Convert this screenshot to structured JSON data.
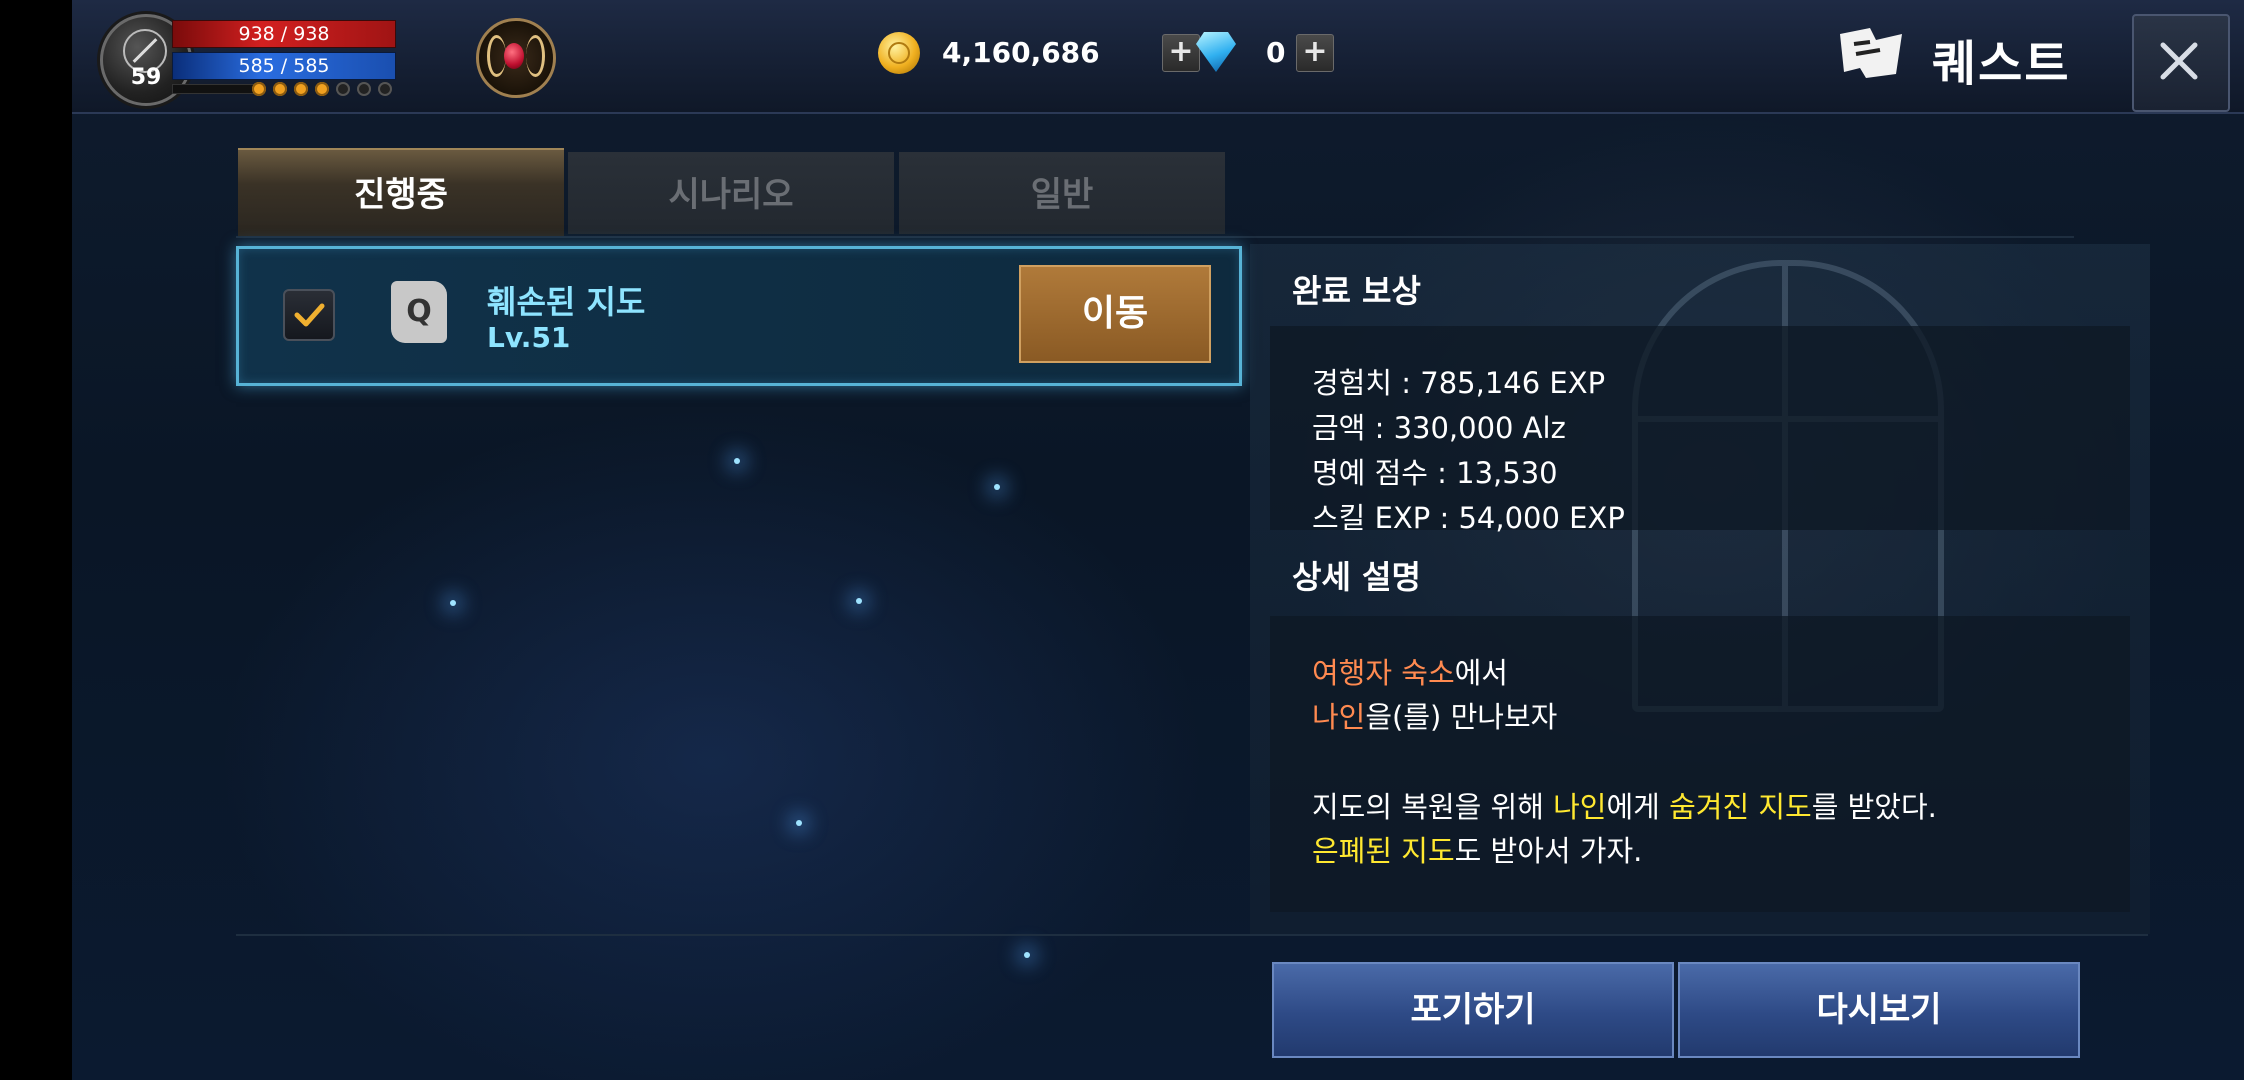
{
  "player": {
    "level": "59",
    "hp": "938 / 938",
    "mp": "585 / 585",
    "progress_dots_filled": 4,
    "progress_dots_total": 7
  },
  "currency": {
    "alz": "4,160,686",
    "gems": "0",
    "plus_label": "+"
  },
  "header": {
    "title": "퀘스트"
  },
  "tabs": [
    {
      "label": "진행중",
      "active": true
    },
    {
      "label": "시나리오",
      "active": false
    },
    {
      "label": "일반",
      "active": false
    }
  ],
  "quests": [
    {
      "name": "훼손된 지도",
      "level": "Lv.51",
      "icon_letter": "Q",
      "checked": true,
      "move_label": "이동"
    }
  ],
  "rewards": {
    "title": "완료 보상",
    "items": [
      "경험치 : 785,146 EXP",
      "금액 : 330,000 Alz",
      "명예 점수 : 13,530",
      "스킬 EXP : 54,000 EXP"
    ]
  },
  "description": {
    "title": "상세 설명",
    "line1": {
      "highlight": "여행자 숙소",
      "rest": "에서"
    },
    "line2": {
      "highlight": "나인",
      "rest": "을(를) 만나보자"
    },
    "line3": {
      "part1": "지도의 복원을 위해 ",
      "hl1": "나인",
      "part2": "에게 ",
      "hl2": "숨겨진 지도",
      "part3": "를 받았다."
    },
    "line4": {
      "hl": "은폐된 지도",
      "rest": "도 받아서 가자."
    }
  },
  "buttons": {
    "abandon": "포기하기",
    "review": "다시보기"
  },
  "colors": {
    "accent_orange": "#ff8a50",
    "accent_yellow": "#ffe830",
    "quest_cyan": "#8ee4ff",
    "move_button": "#a0703a"
  }
}
